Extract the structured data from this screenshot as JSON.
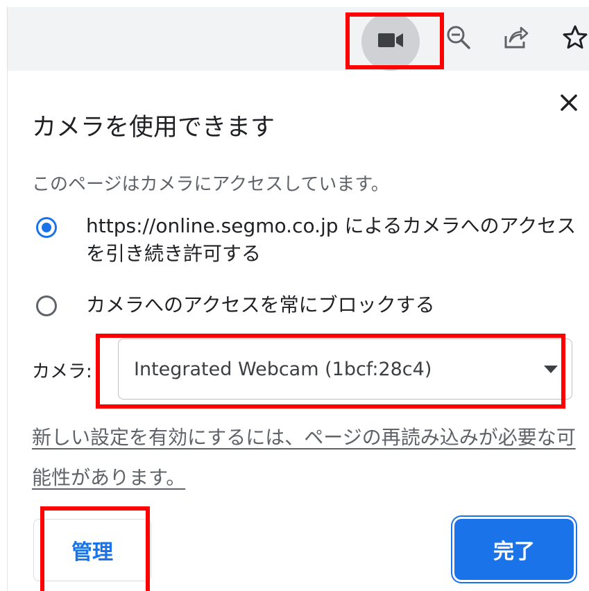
{
  "toolbar": {
    "icons": [
      "camera-icon",
      "zoom-out-icon",
      "share-icon",
      "bookmark-star-icon"
    ]
  },
  "popup": {
    "title": "カメラを使用できます",
    "description": "このページはカメラにアクセスしています。",
    "options": [
      {
        "label_line1": "https://online.segmo.co.jp によるカメラへのアクセス",
        "label_line2": "を引き続き許可する",
        "selected": true
      },
      {
        "label_line1": "カメラへのアクセスを常にブロックする",
        "selected": false
      }
    ],
    "camera_label": "カメラ:",
    "camera_select_value": "Integrated Webcam (1bcf:28c4)",
    "reload_note": "新しい設定を有効にするには、ページの再読み込みが必要な可能性があります。",
    "manage_label": "管理",
    "done_label": "完了"
  },
  "colors": {
    "accent": "#1a73e8",
    "highlight": "#ff0000",
    "toolbar_bg": "#f1f3f4"
  }
}
